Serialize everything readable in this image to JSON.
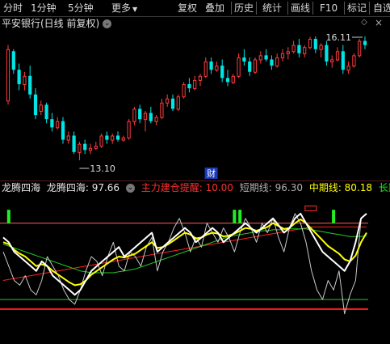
{
  "toolbar": {
    "items": [
      "分时",
      "1分钟",
      "5分钟",
      "更多",
      "复权",
      "叠加",
      "历史",
      "统计",
      "画线",
      "F10",
      "标记",
      "自选"
    ],
    "more_icon": "triangle-down-icon"
  },
  "price_chart": {
    "title": "平安银行(日线 前复权)",
    "dropdown_icon": "chevron-down-icon",
    "high_label": "16.11",
    "low_label": "13.10",
    "event_badge": "财",
    "colors": {
      "up": "#ff3c3c",
      "down": "#00e5e5",
      "background": "#000000"
    },
    "candles": [
      {
        "o": 14.55,
        "h": 15.9,
        "l": 14.45,
        "c": 15.8
      },
      {
        "o": 15.75,
        "h": 15.8,
        "l": 15.2,
        "c": 15.3
      },
      {
        "o": 15.3,
        "h": 15.45,
        "l": 14.8,
        "c": 14.95
      },
      {
        "o": 14.95,
        "h": 15.25,
        "l": 14.8,
        "c": 15.15
      },
      {
        "o": 15.15,
        "h": 15.4,
        "l": 14.6,
        "c": 14.7
      },
      {
        "o": 14.7,
        "h": 14.85,
        "l": 14.1,
        "c": 14.2
      },
      {
        "o": 14.3,
        "h": 14.55,
        "l": 14.2,
        "c": 14.45
      },
      {
        "o": 14.45,
        "h": 14.5,
        "l": 14.0,
        "c": 14.1
      },
      {
        "o": 14.1,
        "h": 14.25,
        "l": 13.8,
        "c": 13.9
      },
      {
        "o": 13.9,
        "h": 14.15,
        "l": 13.85,
        "c": 14.05
      },
      {
        "o": 14.05,
        "h": 14.15,
        "l": 13.5,
        "c": 13.6
      },
      {
        "o": 13.6,
        "h": 13.8,
        "l": 13.5,
        "c": 13.7
      },
      {
        "o": 13.7,
        "h": 13.8,
        "l": 13.25,
        "c": 13.3
      },
      {
        "o": 13.3,
        "h": 13.55,
        "l": 13.1,
        "c": 13.5
      },
      {
        "o": 13.5,
        "h": 13.6,
        "l": 13.25,
        "c": 13.35
      },
      {
        "o": 13.35,
        "h": 13.5,
        "l": 13.25,
        "c": 13.4
      },
      {
        "o": 13.4,
        "h": 13.55,
        "l": 13.35,
        "c": 13.45
      },
      {
        "o": 13.45,
        "h": 13.75,
        "l": 13.4,
        "c": 13.7
      },
      {
        "o": 13.7,
        "h": 13.8,
        "l": 13.5,
        "c": 13.6
      },
      {
        "o": 13.6,
        "h": 13.75,
        "l": 13.5,
        "c": 13.7
      },
      {
        "o": 13.7,
        "h": 13.8,
        "l": 13.55,
        "c": 13.6
      },
      {
        "o": 13.6,
        "h": 13.7,
        "l": 13.55,
        "c": 13.65
      },
      {
        "o": 13.65,
        "h": 14.1,
        "l": 13.6,
        "c": 14.05
      },
      {
        "o": 14.05,
        "h": 14.4,
        "l": 13.95,
        "c": 14.35
      },
      {
        "o": 14.35,
        "h": 14.45,
        "l": 14.0,
        "c": 14.1
      },
      {
        "o": 14.1,
        "h": 14.3,
        "l": 13.8,
        "c": 14.25
      },
      {
        "o": 14.25,
        "h": 14.4,
        "l": 14.0,
        "c": 14.05
      },
      {
        "o": 14.05,
        "h": 14.2,
        "l": 13.95,
        "c": 14.15
      },
      {
        "o": 14.15,
        "h": 14.6,
        "l": 14.1,
        "c": 14.5
      },
      {
        "o": 14.5,
        "h": 14.7,
        "l": 14.4,
        "c": 14.6
      },
      {
        "o": 14.6,
        "h": 14.7,
        "l": 14.3,
        "c": 14.35
      },
      {
        "o": 14.35,
        "h": 14.7,
        "l": 14.3,
        "c": 14.65
      },
      {
        "o": 14.65,
        "h": 15.0,
        "l": 14.6,
        "c": 14.95
      },
      {
        "o": 14.95,
        "h": 15.1,
        "l": 14.75,
        "c": 14.85
      },
      {
        "o": 14.85,
        "h": 15.15,
        "l": 14.8,
        "c": 15.05
      },
      {
        "o": 15.05,
        "h": 15.2,
        "l": 14.9,
        "c": 15.15
      },
      {
        "o": 15.15,
        "h": 15.6,
        "l": 15.1,
        "c": 15.5
      },
      {
        "o": 15.5,
        "h": 15.6,
        "l": 15.2,
        "c": 15.3
      },
      {
        "o": 15.3,
        "h": 15.5,
        "l": 15.25,
        "c": 15.4
      },
      {
        "o": 15.4,
        "h": 15.55,
        "l": 15.0,
        "c": 15.1
      },
      {
        "o": 15.1,
        "h": 15.3,
        "l": 14.9,
        "c": 15.0
      },
      {
        "o": 15.0,
        "h": 15.2,
        "l": 14.95,
        "c": 15.15
      },
      {
        "o": 15.15,
        "h": 15.7,
        "l": 15.1,
        "c": 15.6
      },
      {
        "o": 15.6,
        "h": 15.8,
        "l": 15.4,
        "c": 15.5
      },
      {
        "o": 15.5,
        "h": 15.6,
        "l": 15.15,
        "c": 15.25
      },
      {
        "o": 15.25,
        "h": 15.6,
        "l": 15.2,
        "c": 15.55
      },
      {
        "o": 15.55,
        "h": 15.75,
        "l": 15.45,
        "c": 15.65
      },
      {
        "o": 15.65,
        "h": 15.8,
        "l": 15.5,
        "c": 15.55
      },
      {
        "o": 15.55,
        "h": 15.65,
        "l": 15.3,
        "c": 15.4
      },
      {
        "o": 15.4,
        "h": 15.7,
        "l": 15.35,
        "c": 15.6
      },
      {
        "o": 15.6,
        "h": 15.8,
        "l": 15.5,
        "c": 15.7
      },
      {
        "o": 15.7,
        "h": 15.85,
        "l": 15.55,
        "c": 15.75
      },
      {
        "o": 15.75,
        "h": 16.0,
        "l": 15.7,
        "c": 15.9
      },
      {
        "o": 15.9,
        "h": 16.05,
        "l": 15.6,
        "c": 15.7
      },
      {
        "o": 15.7,
        "h": 15.9,
        "l": 15.6,
        "c": 15.85
      },
      {
        "o": 15.85,
        "h": 16.1,
        "l": 15.8,
        "c": 16.05
      },
      {
        "o": 16.05,
        "h": 16.11,
        "l": 15.7,
        "c": 15.8
      },
      {
        "o": 15.8,
        "h": 15.95,
        "l": 15.6,
        "c": 15.9
      },
      {
        "o": 15.9,
        "h": 16.0,
        "l": 15.4,
        "c": 15.5
      },
      {
        "o": 15.5,
        "h": 15.65,
        "l": 15.35,
        "c": 15.55
      },
      {
        "o": 15.55,
        "h": 15.85,
        "l": 15.5,
        "c": 15.75
      },
      {
        "o": 15.75,
        "h": 15.9,
        "l": 15.2,
        "c": 15.3
      },
      {
        "o": 15.3,
        "h": 15.5,
        "l": 15.2,
        "c": 15.4
      },
      {
        "o": 15.4,
        "h": 15.7,
        "l": 15.35,
        "c": 15.65
      },
      {
        "o": 15.65,
        "h": 16.05,
        "l": 15.6,
        "c": 16.0
      },
      {
        "o": 16.0,
        "h": 16.11,
        "l": 15.8,
        "c": 15.9
      }
    ],
    "high_index": 65,
    "low_index": 13,
    "event_index": 37
  },
  "indicator": {
    "name_label": "龙腾四海",
    "name_value_label": "龙腾四海: 97.66",
    "items": [
      {
        "text": "主力建仓提醒: 10.00",
        "color": "#ff3030"
      },
      {
        "text": "短期线: 96.30",
        "color": "#b0b0b0"
      },
      {
        "text": "中期线: 80.18",
        "color": "#ffff00"
      },
      {
        "text": "长期线:",
        "color": "#22ee22"
      }
    ],
    "dropdown_icon": "chevron-down-icon",
    "levels": {
      "upper": 90,
      "lower": 10,
      "bottom": 0
    },
    "short_line": [
      60,
      45,
      30,
      25,
      35,
      20,
      15,
      30,
      55,
      45,
      35,
      20,
      10,
      5,
      20,
      40,
      55,
      50,
      35,
      55,
      70,
      45,
      40,
      60,
      55,
      45,
      65,
      75,
      40,
      60,
      70,
      85,
      95,
      80,
      60,
      75,
      65,
      90,
      80,
      70,
      85,
      75,
      60,
      80,
      95,
      85,
      70,
      90,
      80,
      95,
      75,
      60,
      85,
      100,
      90,
      70,
      40,
      20,
      10,
      30,
      20,
      40,
      -5,
      15,
      30,
      95,
      100
    ],
    "white_line": [
      75,
      70,
      60,
      55,
      50,
      45,
      40,
      50,
      45,
      35,
      30,
      25,
      20,
      15,
      20,
      30,
      40,
      45,
      50,
      55,
      60,
      65,
      55,
      60,
      65,
      70,
      75,
      80,
      60,
      65,
      70,
      75,
      80,
      85,
      80,
      70,
      75,
      80,
      85,
      80,
      70,
      75,
      80,
      85,
      90,
      85,
      80,
      85,
      90,
      95,
      88,
      80,
      85,
      95,
      100,
      90,
      80,
      70,
      60,
      55,
      50,
      45,
      40,
      50,
      70,
      95,
      100
    ],
    "yellow_line": [
      70,
      68,
      62,
      58,
      55,
      50,
      45,
      47,
      45,
      40,
      36,
      32,
      28,
      25,
      26,
      30,
      36,
      40,
      44,
      48,
      52,
      55,
      54,
      56,
      58,
      62,
      66,
      70,
      64,
      65,
      68,
      72,
      76,
      80,
      78,
      74,
      75,
      78,
      80,
      79,
      76,
      77,
      79,
      82,
      85,
      84,
      82,
      84,
      86,
      90,
      87,
      84,
      85,
      90,
      94,
      90,
      84,
      78,
      72,
      66,
      62,
      58,
      52,
      50,
      56,
      70,
      80
    ],
    "green_line": [
      68,
      66,
      64,
      62,
      60,
      58,
      56,
      54,
      52,
      50,
      48,
      46,
      44,
      42,
      40,
      39,
      38,
      38,
      38,
      38,
      38,
      39,
      40,
      41,
      42,
      44,
      46,
      48,
      50,
      52,
      54,
      56,
      58,
      60,
      62,
      64,
      66,
      68,
      70,
      72,
      74,
      76,
      77,
      78,
      79,
      80,
      81,
      82,
      82,
      83,
      83,
      83,
      84,
      84,
      84,
      84,
      83,
      82,
      81,
      80,
      79,
      78,
      77,
      76,
      76,
      76,
      77
    ],
    "red_line": [
      30,
      31,
      32,
      33,
      34,
      35,
      36,
      37,
      38,
      39,
      40,
      41,
      42,
      43,
      44,
      45,
      46,
      47,
      48,
      49,
      50,
      51,
      52,
      53,
      54,
      55,
      56,
      57,
      58,
      59,
      60,
      61,
      62,
      63,
      64,
      65,
      66,
      67,
      68,
      69,
      70,
      71,
      72,
      73,
      74,
      75,
      76,
      77,
      78,
      79,
      80,
      81,
      82,
      83,
      84,
      85,
      86,
      86,
      86,
      86,
      86,
      86,
      86,
      86,
      86,
      86,
      86
    ],
    "signal_indices": [
      1,
      42,
      43,
      60
    ],
    "colors": {
      "short": "#c8c8c8",
      "white": "#ffffff",
      "yellow": "#ffff00",
      "green": "#22cc22",
      "red": "#ff2020",
      "upper_line": "#ff6060",
      "lower_line": "#22cc22",
      "bottom_line": "#ff2020"
    }
  }
}
